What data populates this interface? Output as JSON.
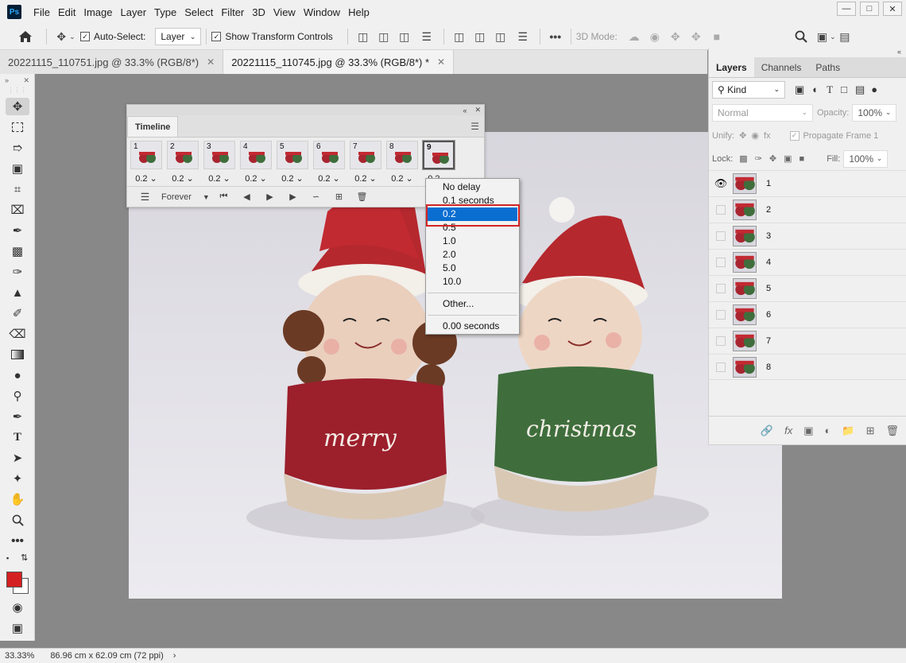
{
  "menubar": {
    "logo": "Ps",
    "items": [
      "File",
      "Edit",
      "Image",
      "Layer",
      "Type",
      "Select",
      "Filter",
      "3D",
      "View",
      "Window",
      "Help"
    ]
  },
  "options": {
    "auto_select_label": "Auto-Select:",
    "auto_select_value": "Layer",
    "transform_label": "Show Transform Controls",
    "mode_3d_label": "3D Mode:"
  },
  "tabs": [
    {
      "label": "20221115_110751.jpg @ 33.3% (RGB/8*)",
      "active": false
    },
    {
      "label": "20221115_110745.jpg @ 33.3% (RGB/8*) *",
      "active": true
    }
  ],
  "timeline": {
    "title": "Timeline",
    "frames": [
      {
        "num": "1",
        "delay": "0.2"
      },
      {
        "num": "2",
        "delay": "0.2"
      },
      {
        "num": "3",
        "delay": "0.2"
      },
      {
        "num": "4",
        "delay": "0.2"
      },
      {
        "num": "5",
        "delay": "0.2"
      },
      {
        "num": "6",
        "delay": "0.2"
      },
      {
        "num": "7",
        "delay": "0.2"
      },
      {
        "num": "8",
        "delay": "0.2"
      },
      {
        "num": "9",
        "delay": "0.2"
      }
    ],
    "loop": "Forever"
  },
  "delay_menu": {
    "items": [
      "No delay",
      "0.1 seconds",
      "0.2",
      "0.5",
      "1.0",
      "2.0",
      "5.0",
      "10.0"
    ],
    "selected": "0.2",
    "other": "Other...",
    "current": "0.00 seconds"
  },
  "layers_panel": {
    "tabs": [
      "Layers",
      "Channels",
      "Paths"
    ],
    "kind": "Kind",
    "blend": "Normal",
    "opacity_label": "Opacity:",
    "opacity": "100%",
    "unify_label": "Unify:",
    "propagate_label": "Propagate Frame 1",
    "lock_label": "Lock:",
    "fill_label": "Fill:",
    "fill": "100%",
    "layers": [
      {
        "name": "1",
        "visible": true
      },
      {
        "name": "2",
        "visible": false
      },
      {
        "name": "3",
        "visible": false
      },
      {
        "name": "4",
        "visible": false
      },
      {
        "name": "5",
        "visible": false
      },
      {
        "name": "6",
        "visible": false
      },
      {
        "name": "7",
        "visible": false
      },
      {
        "name": "8",
        "visible": false
      }
    ]
  },
  "photo": {
    "left_text": "merry",
    "right_text": "christmas"
  },
  "status": {
    "zoom": "33.33%",
    "doc_size": "86.96 cm x 62.09 cm (72 ppi)"
  },
  "colors": {
    "foreground": "#d42020",
    "background": "#ffffff",
    "highlight": "#0a6ed1",
    "annotation": "#d32424"
  }
}
